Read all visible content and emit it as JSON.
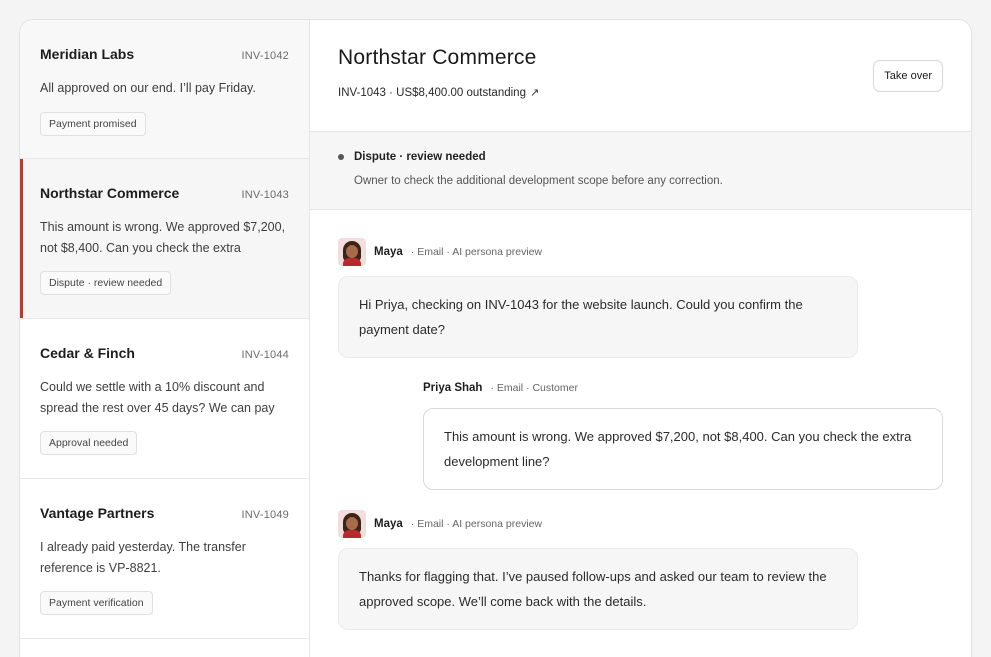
{
  "sidebar": {
    "conversations": [
      {
        "name": "Meridian Labs",
        "invoice": "INV-1042",
        "snippet": "All approved on our end. I’ll pay Friday.",
        "tag": "Payment promised"
      },
      {
        "name": "Northstar Commerce",
        "invoice": "INV-1043",
        "snippet": "This amount is wrong. We approved $7,200, not $8,400. Can you check the extra development line?",
        "tag": "Dispute · review needed"
      },
      {
        "name": "Cedar & Finch",
        "invoice": "INV-1044",
        "snippet": "Could we settle with a 10% discount and spread the rest over 45 days? We can pay half this week.",
        "tag": "Approval needed"
      },
      {
        "name": "Vantage Partners",
        "invoice": "INV-1049",
        "snippet": "I already paid yesterday. The transfer reference is VP-8821.",
        "tag": "Payment verification"
      }
    ]
  },
  "header": {
    "title": "Northstar Commerce",
    "subtitle": "INV-1043 · US$8,400.00 outstanding",
    "takeover_label": "Take over"
  },
  "status": {
    "label": "Dispute · review needed",
    "note": "Owner to check the additional development scope before any correction."
  },
  "thread": {
    "messages": [
      {
        "sender": "Maya",
        "meta": "· Email · AI persona preview",
        "text": "Hi Priya, checking on INV-1043 for the website launch. Could you confirm the payment date?"
      },
      {
        "sender": "Priya Shah",
        "meta": "· Email · Customer",
        "text": "This amount is wrong. We approved $7,200, not $8,400. Can you check the extra development line?"
      },
      {
        "sender": "Maya",
        "meta": "· Email · AI persona preview",
        "text": "Thanks for flagging that. I’ve paused follow-ups and asked our team to review the approved scope. We’ll come back with the details."
      }
    ]
  },
  "colors": {
    "accent": "#c0392b"
  },
  "icons": {
    "external_link": "external-link-icon",
    "status_dot": "status-dot-icon",
    "avatar": "avatar-icon"
  }
}
